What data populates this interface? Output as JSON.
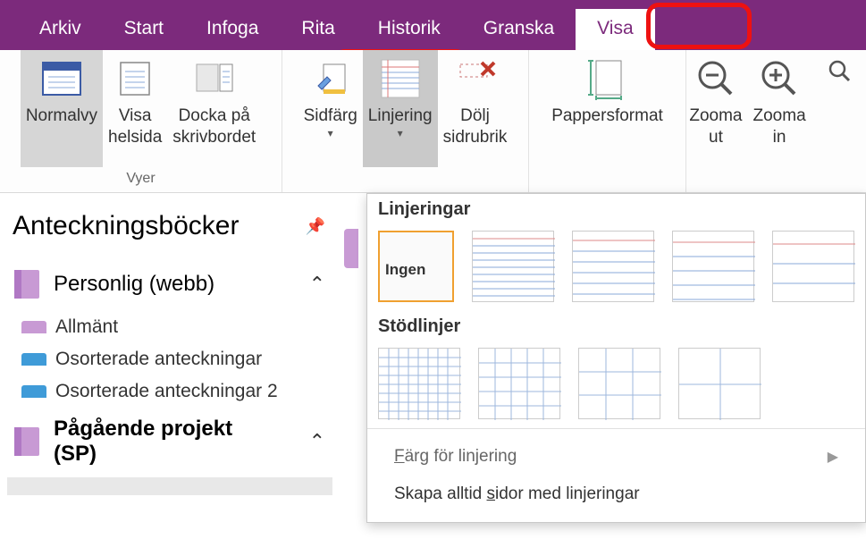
{
  "tabs": {
    "arkiv": "Arkiv",
    "start": "Start",
    "infoga": "Infoga",
    "rita": "Rita",
    "historik": "Historik",
    "granska": "Granska",
    "visa": "Visa"
  },
  "ribbon": {
    "views_group_label": "Vyer",
    "normalvy": "Normalvy",
    "visa_helsida_l1": "Visa",
    "visa_helsida_l2": "helsida",
    "docka_l1": "Docka på",
    "docka_l2": "skrivbordet",
    "sidfarg": "Sidfärg",
    "linjering": "Linjering",
    "dolj_l1": "Dölj",
    "dolj_l2": "sidrubrik",
    "pappersformat": "Pappersformat",
    "zoom_ut_l1": "Zooma",
    "zoom_ut_l2": "ut",
    "zoom_in_l1": "Zooma",
    "zoom_in_l2": "in"
  },
  "gallery": {
    "sect1": "Linjeringar",
    "ingen": "Ingen",
    "sect2": "Stödlinjer",
    "footer_color": "Färg för linjering",
    "footer_always": "Skapa alltid sidor med linjeringar"
  },
  "sidebar": {
    "title": "Anteckningsböcker",
    "nb_personal": "Personlig (webb)",
    "sec_allmant": "Allmänt",
    "sec_osorterade": "Osorterade anteckningar",
    "sec_osorterade2": "Osorterade anteckningar 2",
    "nb_projekt_l1": "Pågående projekt",
    "nb_projekt_l2": "(SP)"
  },
  "colors": {
    "purple": "#7c2a7c",
    "lilac": "#c89ad4",
    "blue_tab": "#3f9bd8",
    "red_annotation": "#e11b1b"
  }
}
